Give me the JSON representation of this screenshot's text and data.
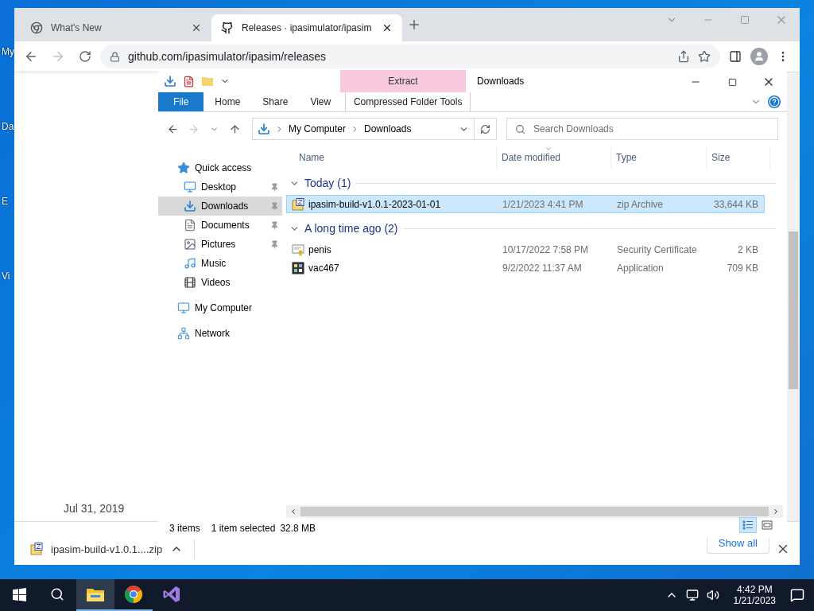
{
  "desktop": {
    "icons": [
      {
        "label": "My"
      },
      {
        "label": "Da"
      },
      {
        "label": "E"
      },
      {
        "label": "Vi"
      }
    ]
  },
  "browser": {
    "tabs": [
      {
        "title": "What's New",
        "kind": "chrome",
        "selected": false
      },
      {
        "title": "Releases · ipasimulator/ipasim",
        "kind": "github",
        "selected": true
      }
    ],
    "address": "github.com/ipasimulator/ipasim/releases",
    "page_text": "Jul 31, 2019",
    "download": {
      "file": "ipasim-build-v1.0.1....zip"
    },
    "show_all": "Show all"
  },
  "explorer": {
    "title": "Downloads",
    "context_header": "Extract",
    "ribbon_tabs": [
      {
        "label": "File",
        "kind": "file"
      },
      {
        "label": "Home",
        "kind": "plain"
      },
      {
        "label": "Share",
        "kind": "plain"
      },
      {
        "label": "View",
        "kind": "plain"
      },
      {
        "label": "Compressed Folder Tools",
        "kind": "context"
      }
    ],
    "breadcrumb": [
      "My Computer",
      "Downloads"
    ],
    "search": {
      "placeholder": "Search Downloads"
    },
    "nav": [
      {
        "label": "Quick access",
        "kind": "star",
        "selected": false,
        "children": [
          {
            "label": "Desktop",
            "kind": "desktop",
            "selected": false,
            "pinned": true
          },
          {
            "label": "Downloads",
            "kind": "download",
            "selected": true,
            "pinned": true
          },
          {
            "label": "Documents",
            "kind": "documents",
            "selected": false,
            "pinned": true
          },
          {
            "label": "Pictures",
            "kind": "pictures",
            "selected": false,
            "pinned": true
          },
          {
            "label": "Music",
            "kind": "music",
            "selected": false,
            "pinned": false
          },
          {
            "label": "Videos",
            "kind": "videos",
            "selected": false,
            "pinned": false
          }
        ]
      },
      {
        "label": "My Computer",
        "kind": "computer",
        "selected": false
      },
      {
        "label": "Network",
        "kind": "network",
        "selected": false
      }
    ],
    "columns": [
      {
        "label": "Name",
        "sorted": false
      },
      {
        "label": "Date modified",
        "sorted": true
      },
      {
        "label": "Type",
        "sorted": false
      },
      {
        "label": "Size",
        "sorted": false
      }
    ],
    "groups": [
      {
        "title": "Today (1)",
        "expanded": true,
        "files": [
          {
            "name": "ipasim-build-v1.0.1-2023-01-01",
            "date": "1/21/2023 4:41 PM",
            "type": "zip Archive",
            "size": "33,644 KB",
            "kind": "zip",
            "selected": true
          }
        ]
      },
      {
        "title": "A long time ago (2)",
        "expanded": true,
        "files": [
          {
            "name": "penis",
            "date": "10/17/2022 7:58 PM",
            "type": "Security Certificate",
            "size": "2 KB",
            "kind": "certificate",
            "selected": false
          },
          {
            "name": "vac467",
            "date": "9/2/2022 11:37 AM",
            "type": "Application",
            "size": "709 KB",
            "kind": "application",
            "selected": false
          }
        ]
      }
    ],
    "status": {
      "count": "3 items",
      "selection": "1 item selected",
      "size": "32.8 MB"
    },
    "views": [
      {
        "kind": "details",
        "selected": true
      },
      {
        "kind": "tiles",
        "selected": false
      }
    ]
  },
  "taskbar": {
    "apps": [
      {
        "kind": "explorer",
        "selected": true,
        "running": true
      },
      {
        "kind": "chrome",
        "selected": false,
        "running": true
      },
      {
        "kind": "studio",
        "selected": false,
        "running": false
      }
    ],
    "time": "4:42 PM",
    "date": "1/21/2023"
  }
}
